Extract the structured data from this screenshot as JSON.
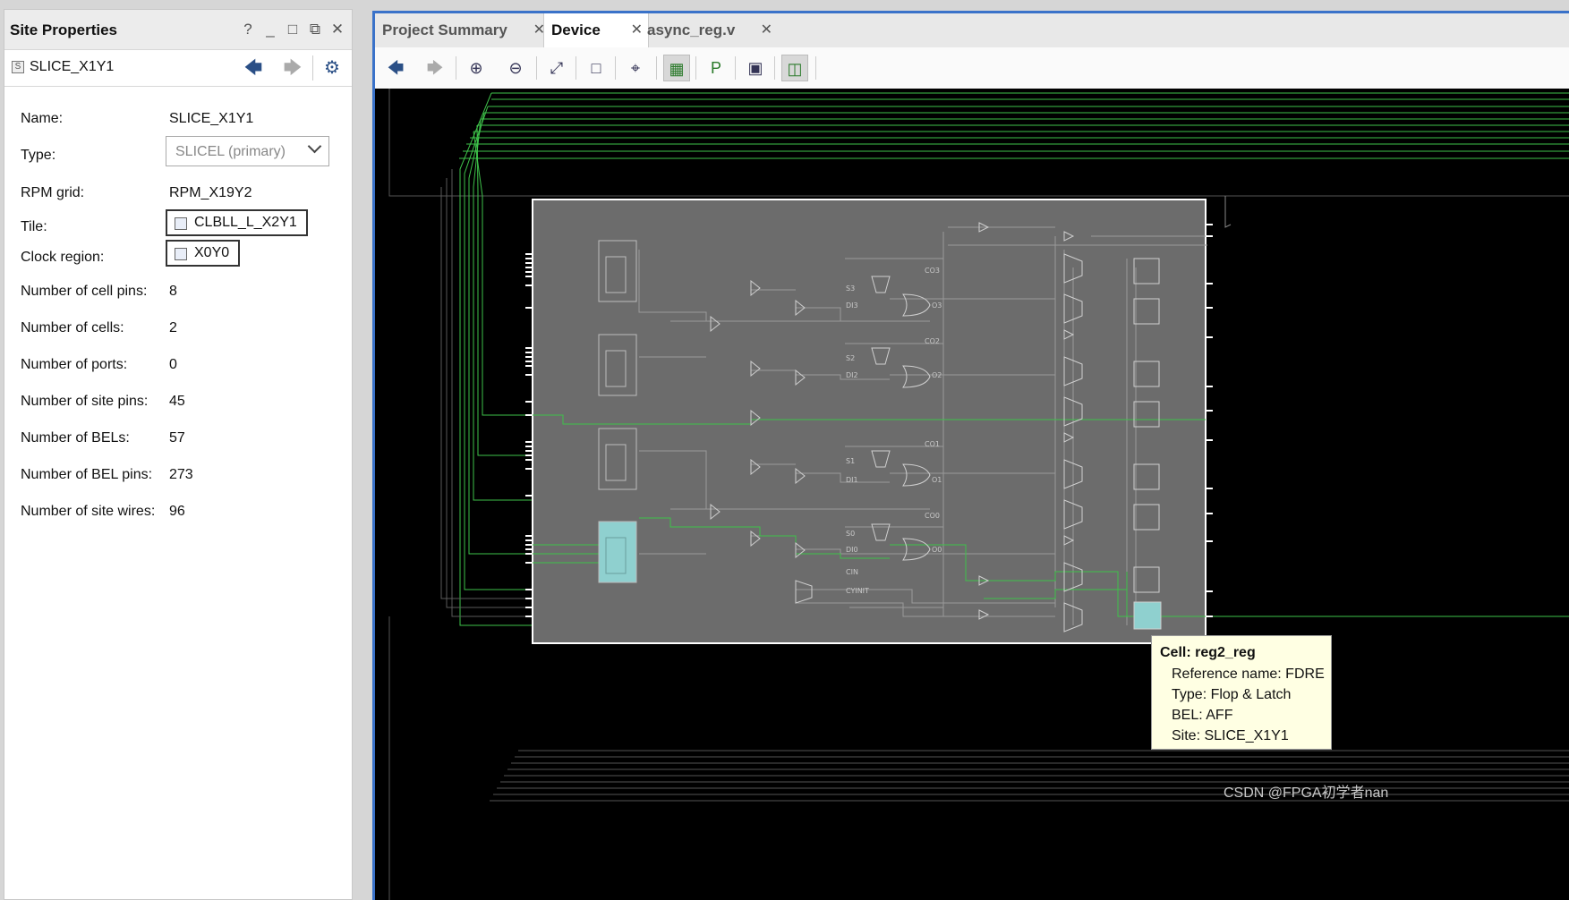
{
  "panel": {
    "title": "Site Properties",
    "controls": [
      "?",
      "_",
      "□",
      "⧉",
      "✕"
    ],
    "site_name": "SLICE_X1Y1",
    "site_badge": "S",
    "properties": [
      {
        "label": "Name:",
        "value": "SLICE_X1Y1"
      },
      {
        "label": "Type:",
        "value": "SLICEL (primary)"
      },
      {
        "label": "RPM grid:",
        "value": "RPM_X19Y2"
      },
      {
        "label": "Tile:",
        "value": "CLBLL_L_X2Y1"
      },
      {
        "label": "Clock region:",
        "value": "X0Y0"
      },
      {
        "label": "Number of cell pins:",
        "value": "8"
      },
      {
        "label": "Number of cells:",
        "value": "2"
      },
      {
        "label": "Number of ports:",
        "value": "0"
      },
      {
        "label": "Number of site pins:",
        "value": "45"
      },
      {
        "label": "Number of BELs:",
        "value": "57"
      },
      {
        "label": "Number of BEL pins:",
        "value": "273"
      },
      {
        "label": "Number of site wires:",
        "value": "96"
      }
    ]
  },
  "tabs": [
    {
      "label": "Project Summary",
      "active": false
    },
    {
      "label": "Device",
      "active": true
    },
    {
      "label": "async_reg.v",
      "active": false
    }
  ],
  "toolbar_icons": [
    "back-icon",
    "forward-icon",
    "zoom-in-icon",
    "zoom-out-icon",
    "zoom-fit-icon",
    "zoom-area-icon",
    "crosshair-icon",
    "routing-resources-icon",
    "add-pblock-icon",
    "device-view-icon",
    "autofit-selection-icon"
  ],
  "slice_labels": {
    "carry": [
      "CO3",
      "CO2",
      "CO1",
      "CO0"
    ],
    "sel": [
      "S3",
      "S2",
      "S1",
      "S0"
    ],
    "di": [
      "DI3",
      "DI2",
      "DI1",
      "DI0"
    ],
    "o": [
      "O3",
      "O2",
      "O1",
      "O0"
    ],
    "bottom": [
      "CIN",
      "CYINIT"
    ]
  },
  "tooltip": {
    "title": "Cell: reg2_reg",
    "lines": [
      "Reference name: FDRE",
      "Type: Flop & Latch",
      "BEL: AFF",
      "Site: SLICE_X1Y1"
    ]
  },
  "watermark": "CSDN @FPGA初学者nan",
  "colors": {
    "accent": "#3a72c9",
    "site_bg": "#6e6e6e",
    "highlight": "#8fd0cf",
    "net_green": "#3fbf3f",
    "tooltip_bg": "#ffffe3"
  }
}
